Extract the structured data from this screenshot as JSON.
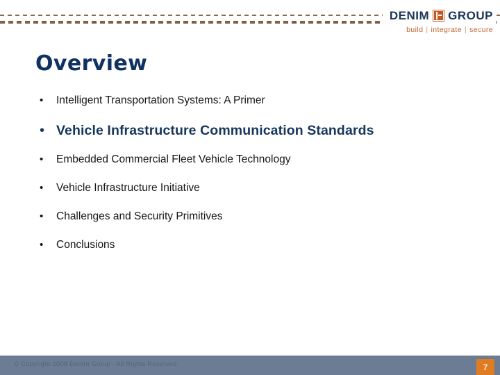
{
  "header": {
    "logo": {
      "word_left": "DENIM",
      "monogram": "DG",
      "word_right": "GROUP",
      "tagline_build": "build",
      "tagline_integrate": "integrate",
      "tagline_secure": "secure",
      "separator": "|",
      "brand_navy": "#1c3557",
      "brand_orange": "#c05a22"
    },
    "rule_color": "#8a6a52"
  },
  "slide": {
    "title": "Overview",
    "title_color": "#103262",
    "bullets": [
      {
        "marker": "•",
        "text": "Intelligent Transportation Systems: A Primer",
        "emphasis": false
      },
      {
        "marker": "•",
        "text": "Vehicle Infrastructure Communication Standards",
        "emphasis": true
      },
      {
        "marker": "•",
        "text": "Embedded Commercial Fleet Vehicle Technology",
        "emphasis": false
      },
      {
        "marker": "•",
        "text": "Vehicle Infrastructure Initiative",
        "emphasis": false
      },
      {
        "marker": "•",
        "text": "Challenges and Security Primitives",
        "emphasis": false
      },
      {
        "marker": "•",
        "text": "Conclusions",
        "emphasis": false
      }
    ]
  },
  "footer": {
    "copyright": "© Copyright 2008 Denim Group - All Rights Reserved",
    "page_number": "7",
    "bar_color": "#6c7c94",
    "page_badge_color": "#e07b24"
  }
}
